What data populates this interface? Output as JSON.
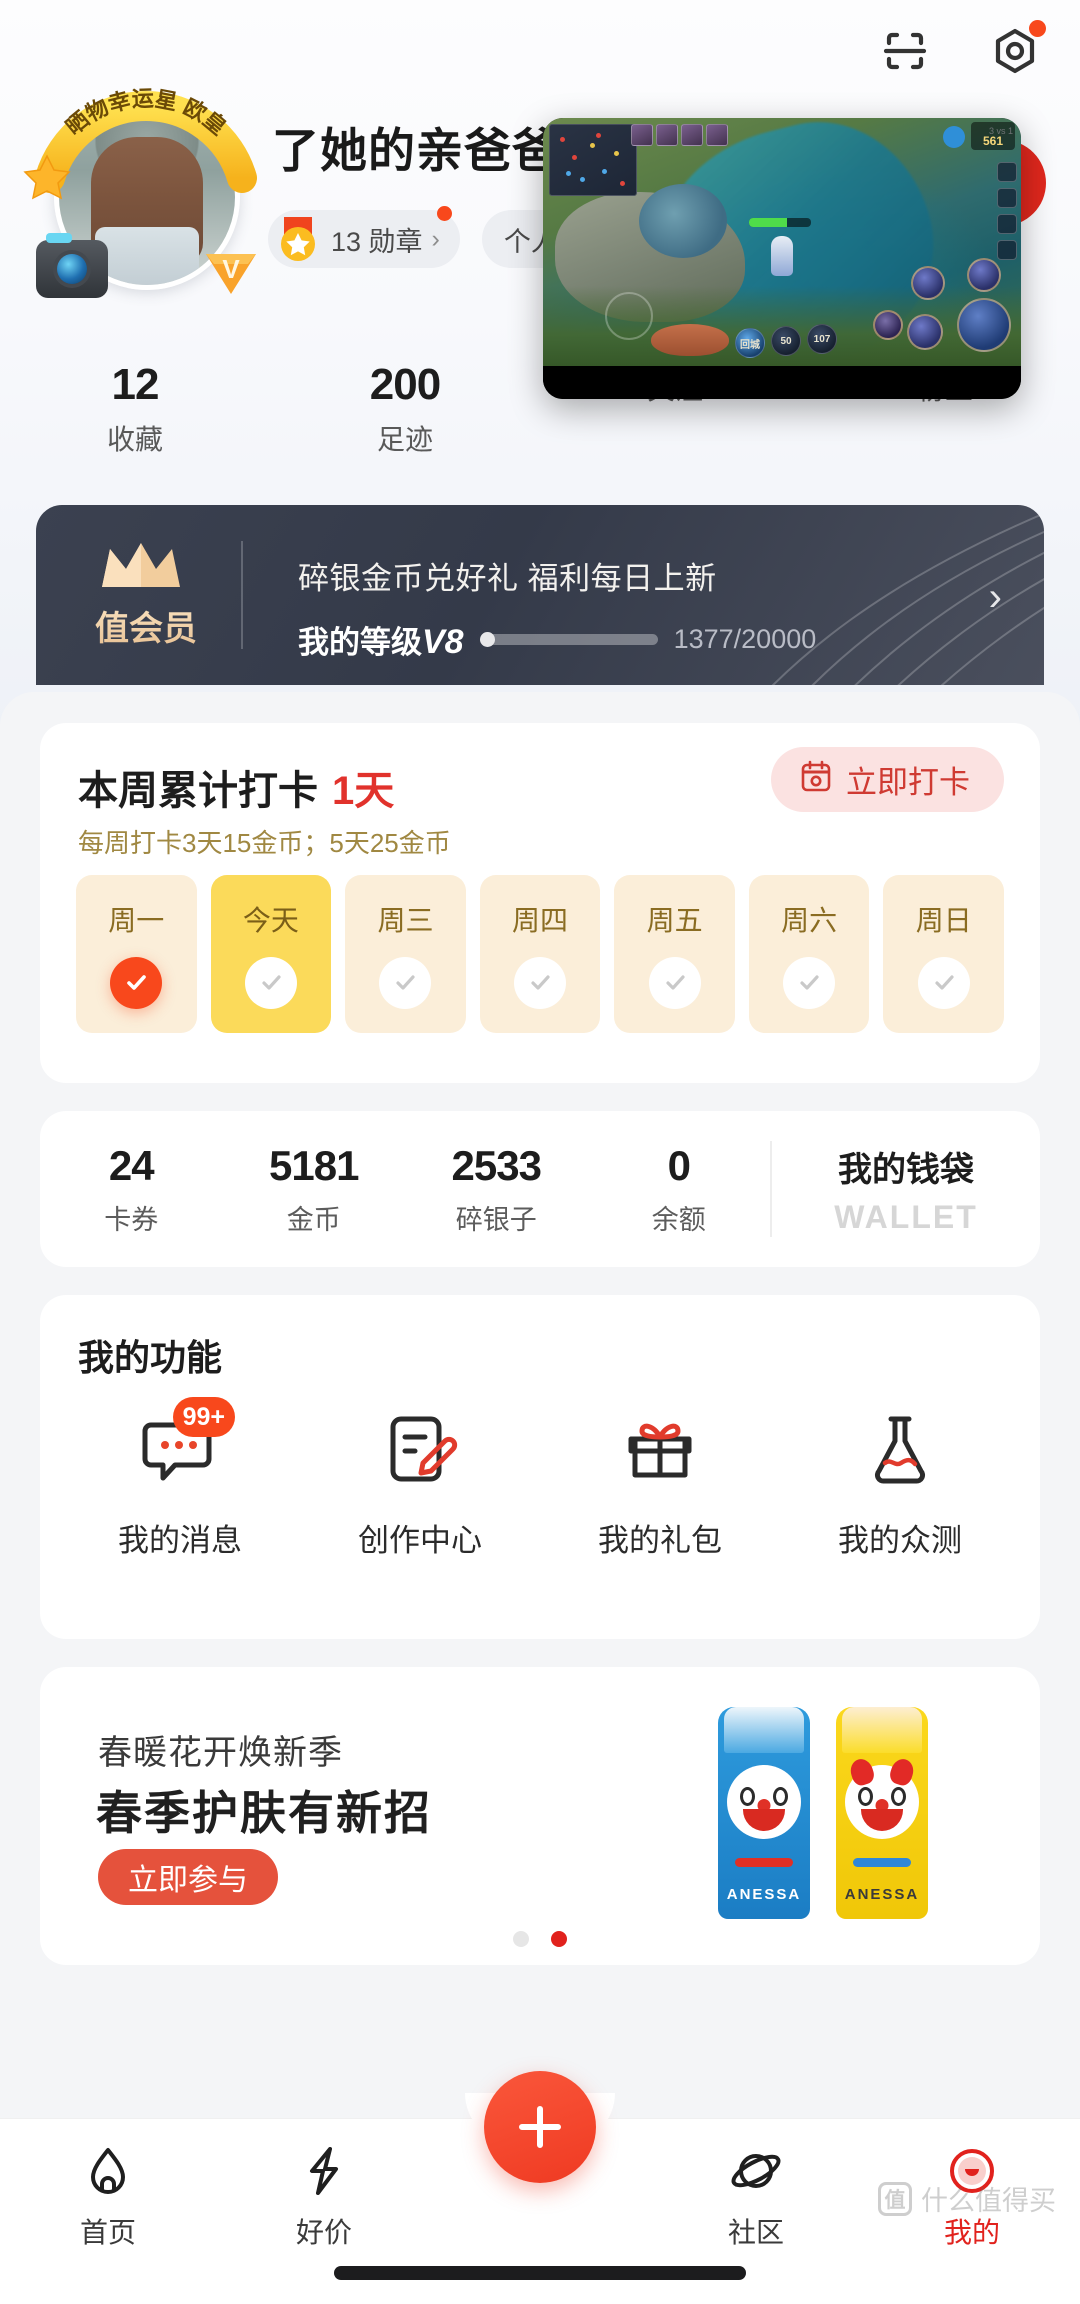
{
  "header": {
    "scan_icon": "scan-icon",
    "settings_icon": "settings-hexagon-icon",
    "settings_has_badge": true
  },
  "profile": {
    "username": "了她的亲爸爸",
    "avatar_banner_text": "晒物幸运星 欧皇",
    "avatar_camera_badge": "camera-icon",
    "avatar_v_badge": "V",
    "badge_pill": {
      "count_label": "13 勋章",
      "chevron": "›",
      "has_red_dot": true
    },
    "second_pill": "个人主页",
    "stats": [
      {
        "value": "12",
        "label": "收藏"
      },
      {
        "value": "200",
        "label": "足迹"
      },
      {
        "value": "",
        "label": "关注"
      },
      {
        "value": "",
        "label": "粉丝"
      }
    ]
  },
  "member_banner": {
    "vip_label": "值会员",
    "crown_icon": "crown-icon",
    "title": "碎银金币兑好礼 福利每日上新",
    "level_label": "我的等级",
    "level_value": "V8",
    "progress_text": "1377/20000",
    "progress_current": 1377,
    "progress_total": 20000,
    "chevron": "›"
  },
  "checkin": {
    "title": "本周累计打卡",
    "days_count": "1天",
    "subtitle": "每周打卡3天15金币；5天25金币",
    "button_label": "立即打卡",
    "button_icon": "calendar-check-icon",
    "days": [
      {
        "label": "周一",
        "state": "done"
      },
      {
        "label": "今天",
        "state": "today"
      },
      {
        "label": "周三",
        "state": "pending"
      },
      {
        "label": "周四",
        "state": "pending"
      },
      {
        "label": "周五",
        "state": "pending"
      },
      {
        "label": "周六",
        "state": "pending"
      },
      {
        "label": "周日",
        "state": "pending"
      }
    ]
  },
  "wallet": {
    "items": [
      {
        "value": "24",
        "label": "卡券"
      },
      {
        "value": "5181",
        "label": "金币"
      },
      {
        "value": "2533",
        "label": "碎银子"
      },
      {
        "value": "0",
        "label": "余额"
      }
    ],
    "wallet_cn": "我的钱袋",
    "wallet_en": "WALLET"
  },
  "functions": {
    "title": "我的功能",
    "items": [
      {
        "label": "我的消息",
        "icon": "message-bubble-icon",
        "badge": "99+"
      },
      {
        "label": "创作中心",
        "icon": "edit-document-icon",
        "badge": ""
      },
      {
        "label": "我的礼包",
        "icon": "gift-box-icon",
        "badge": ""
      },
      {
        "label": "我的众测",
        "icon": "flask-icon",
        "badge": ""
      }
    ]
  },
  "promo": {
    "subtitle": "春暖花开焕新季",
    "title": "春季护肤有新招",
    "cta": "立即参与",
    "product_brand": "ANESSA",
    "dots_total": 2,
    "dots_active_index": 1
  },
  "bottom_nav": {
    "items": [
      {
        "label": "首页",
        "icon": "home-icon",
        "active": false
      },
      {
        "label": "好价",
        "icon": "lightning-tag-icon",
        "active": false
      },
      {
        "label": "社区",
        "icon": "planet-icon",
        "active": false
      },
      {
        "label": "我的",
        "icon": "smiley-circle-icon",
        "active": true
      }
    ],
    "fab_icon": "plus-icon"
  },
  "watermark": {
    "logo": "值",
    "text": "什么值得买"
  },
  "floating_video": {
    "type": "game-pip-window",
    "gold": "561",
    "score": "3 vs 1",
    "items": [
      "回城",
      "50",
      "107"
    ]
  },
  "colors": {
    "accent_red": "#e1221d",
    "fab_orange": "#ee3c23",
    "today_yellow": "#fbda5a",
    "day_bg": "#fbeed9",
    "banner_dark": "#3b4150",
    "page_bg": "#f4f5f7"
  }
}
